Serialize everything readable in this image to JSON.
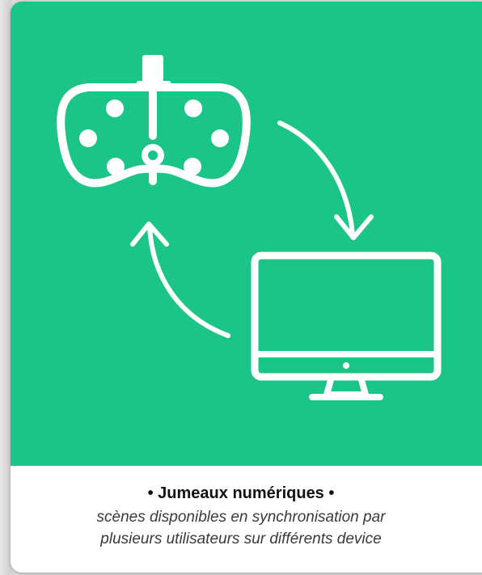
{
  "card": {
    "title": "• Jumeaux numériques •",
    "description_line1": "scènes disponibles en synchronisation par",
    "description_line2": "plusieurs utilisateurs sur différents device"
  },
  "illustration": {
    "background_color": "#1bc487",
    "stroke_color": "#ffffff",
    "icons": [
      "vr-headset-icon",
      "desktop-monitor-icon",
      "arrow-to-monitor-icon",
      "arrow-to-headset-icon"
    ]
  }
}
